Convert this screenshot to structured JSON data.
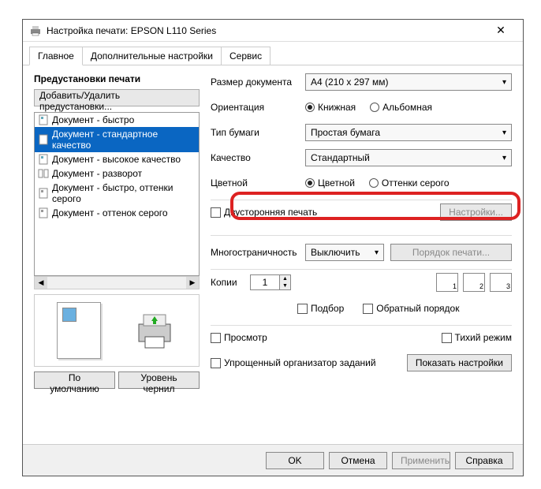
{
  "window": {
    "title": "Настройка печати: EPSON L110 Series"
  },
  "tabs": {
    "main": "Главное",
    "advanced": "Дополнительные настройки",
    "service": "Сервис"
  },
  "presets": {
    "title": "Предустановки печати",
    "add_remove": "Добавить/Удалить предустановки...",
    "items": [
      "Документ - быстро",
      "Документ - стандартное качество",
      "Документ - высокое качество",
      "Документ - разворот",
      "Документ - быстро, оттенки серого",
      "Документ - оттенок серого"
    ],
    "default_btn": "По умолчанию",
    "ink_btn": "Уровень чернил"
  },
  "form": {
    "doc_size_label": "Размер документа",
    "doc_size_value": "A4 (210 x 297 мм)",
    "orientation_label": "Ориентация",
    "orient_portrait": "Книжная",
    "orient_landscape": "Альбомная",
    "paper_type_label": "Тип бумаги",
    "paper_type_value": "Простая бумага",
    "quality_label": "Качество",
    "quality_value": "Стандартный",
    "color_label": "Цветной",
    "color_yes": "Цветной",
    "color_gray": "Оттенки серого",
    "duplex_label": "Двусторонняя печать",
    "settings_btn": "Настройки...",
    "multipage_label": "Многостраничность",
    "multipage_value": "Выключить",
    "page_order_btn": "Порядок печати...",
    "copies_label": "Копии",
    "copies_value": "1",
    "collate_label": "Подбор",
    "reverse_label": "Обратный порядок",
    "preview_label": "Просмотр",
    "quiet_label": "Тихий режим",
    "simple_org_label": "Упрощенный организатор заданий",
    "show_settings_btn": "Показать настройки"
  },
  "buttons": {
    "ok": "OK",
    "cancel": "Отмена",
    "apply": "Применить",
    "help": "Справка"
  }
}
